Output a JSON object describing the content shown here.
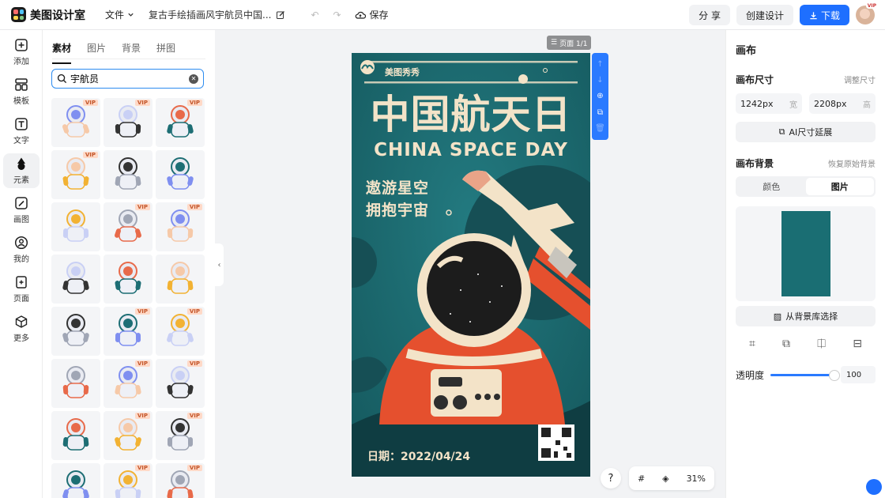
{
  "header": {
    "app_name": "美图设计室",
    "file_menu": "文件",
    "doc_title": "复古手绘插画风宇航员中国...",
    "save_label": "保存",
    "share_label": "分 享",
    "create_label": "创建设计",
    "download_label": "下载",
    "avatar_badge": "VIP"
  },
  "rail": {
    "items": [
      {
        "label": "添加",
        "icon": "plus-square-icon"
      },
      {
        "label": "模板",
        "icon": "template-icon"
      },
      {
        "label": "文字",
        "icon": "text-icon"
      },
      {
        "label": "元素",
        "icon": "shapes-icon"
      },
      {
        "label": "画图",
        "icon": "pencil-icon"
      },
      {
        "label": "我的",
        "icon": "user-icon"
      },
      {
        "label": "页面",
        "icon": "page-icon"
      },
      {
        "label": "更多",
        "icon": "box-icon"
      }
    ],
    "active": "元素"
  },
  "materials": {
    "tabs": [
      "素材",
      "图片",
      "背景",
      "拼图"
    ],
    "active_tab": "素材",
    "search_value": "宇航员",
    "vip_label": "VIP",
    "items": [
      {
        "kind": "astronaut-float",
        "vip": true
      },
      {
        "kind": "astronaut-jump",
        "vip": true
      },
      {
        "kind": "astronaut-flag",
        "vip": true
      },
      {
        "kind": "astronaut-lying",
        "vip": true
      },
      {
        "kind": "astronaut-planet",
        "vip": false
      },
      {
        "kind": "astronaut-walk",
        "vip": false
      },
      {
        "kind": "astronaut-swim",
        "vip": false
      },
      {
        "kind": "kid-astronaut",
        "vip": true
      },
      {
        "kind": "popsicle",
        "vip": true
      },
      {
        "kind": "cartoon-astronaut",
        "vip": false
      },
      {
        "kind": "bravo-astronaut",
        "vip": false
      },
      {
        "kind": "plane-astronaut",
        "vip": false
      },
      {
        "kind": "helmet-grey",
        "vip": false
      },
      {
        "kind": "astronaut-red",
        "vip": true
      },
      {
        "kind": "astronaut-white",
        "vip": true
      },
      {
        "kind": "astronaut-avatar",
        "vip": false
      },
      {
        "kind": "astronaut-circle",
        "vip": true
      },
      {
        "kind": "astronaut-outline",
        "vip": true
      },
      {
        "kind": "astronaut-line",
        "vip": false
      },
      {
        "kind": "kid-3d",
        "vip": true
      },
      {
        "kind": "helmet-green",
        "vip": true
      },
      {
        "kind": "helmet-dark",
        "vip": false
      },
      {
        "kind": "helmet-blue",
        "vip": true
      },
      {
        "kind": "astronaut-yellow",
        "vip": true
      }
    ]
  },
  "canvas": {
    "page_indicator": "页面 1/1",
    "zoom": "31%",
    "help_label": "?",
    "poster": {
      "brand": "美图秀秀",
      "title_cn": "中国航天日",
      "title_en": "CHINA SPACE DAY",
      "slogan_line1": "遨游星空",
      "slogan_line2": "拥抱宇宙",
      "date_text": "日期：2022/04/24"
    }
  },
  "right_panel": {
    "title": "画布",
    "size_label": "画布尺寸",
    "resize_link": "调整尺寸",
    "width_value": "1242px",
    "width_unit": "宽",
    "height_value": "2208px",
    "height_unit": "高",
    "ai_extend": "AI尺寸延展",
    "bg_label": "画布背景",
    "restore_link": "恢复原始背景",
    "seg_color": "颜色",
    "seg_image": "图片",
    "bg_library": "从背景库选择",
    "opacity_label": "透明度",
    "opacity_value": "100",
    "bg_color": "#1a6e73"
  }
}
